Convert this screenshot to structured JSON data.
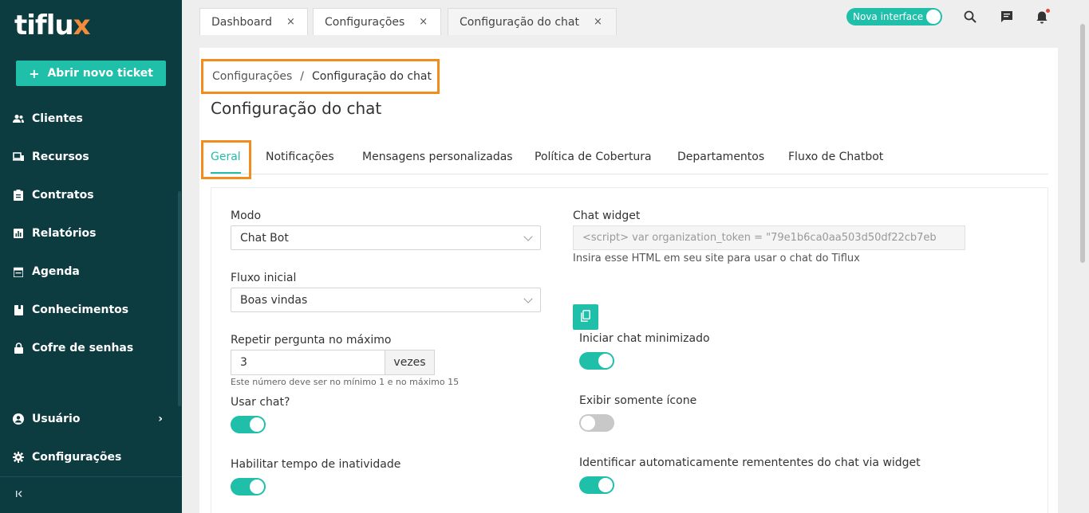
{
  "sidebar": {
    "logo_text": "tiflu",
    "logo_accent": "x",
    "new_ticket_label": "Abrir novo ticket",
    "items": [
      {
        "label": "Clientes",
        "icon": "users-icon"
      },
      {
        "label": "Recursos",
        "icon": "devices-icon"
      },
      {
        "label": "Contratos",
        "icon": "clipboard-icon"
      },
      {
        "label": "Relatórios",
        "icon": "chart-icon"
      },
      {
        "label": "Agenda",
        "icon": "calendar-icon"
      },
      {
        "label": "Conhecimentos",
        "icon": "book-icon"
      },
      {
        "label": "Cofre de senhas",
        "icon": "lock-icon"
      }
    ],
    "bottom_items": [
      {
        "label": "Usuário",
        "icon": "user-icon"
      },
      {
        "label": "Configurações",
        "icon": "gear-icon"
      }
    ],
    "collapse_glyph": "|<"
  },
  "tabs": [
    {
      "label": "Dashboard",
      "close": "×"
    },
    {
      "label": "Configurações",
      "close": "×"
    },
    {
      "label": "Configuração do chat",
      "close": "×"
    }
  ],
  "topbar": {
    "new_interface_label": "Nova interface"
  },
  "breadcrumb": {
    "parent": "Configurações",
    "separator": "/",
    "current": "Configuração do chat"
  },
  "page_title": "Configuração do chat",
  "subtabs": [
    "Geral",
    "Notificações",
    "Mensagens personalizadas",
    "Política de Cobertura",
    "Departamentos",
    "Fluxo de Chatbot"
  ],
  "form": {
    "modo_label": "Modo",
    "modo_value": "Chat Bot",
    "fluxo_label": "Fluxo inicial",
    "fluxo_value": "Boas vindas",
    "repetir_label": "Repetir pergunta no máximo",
    "repetir_value": "3",
    "repetir_addon": "vezes",
    "repetir_help": "Este número deve ser no mínimo 1 e no máximo 15",
    "usar_chat_label": "Usar chat?",
    "inatividade_label": "Habilitar tempo de inatividade",
    "widget_label": "Chat widget",
    "widget_code": "<script>  var organization_token = \"79e1b6ca0aa503d50df22cb7eb",
    "widget_help": "Insira esse HTML em seu site para usar o chat do Tiflux",
    "minimizado_label": "Iniciar chat minimizado",
    "icone_label": "Exibir somente ícone",
    "identificar_label": "Identificar automaticamente remententes do chat via widget"
  },
  "colors": {
    "sidebar_bg": "#0c3b40",
    "accent": "#1fbfa9",
    "highlight": "#f28c1e"
  }
}
